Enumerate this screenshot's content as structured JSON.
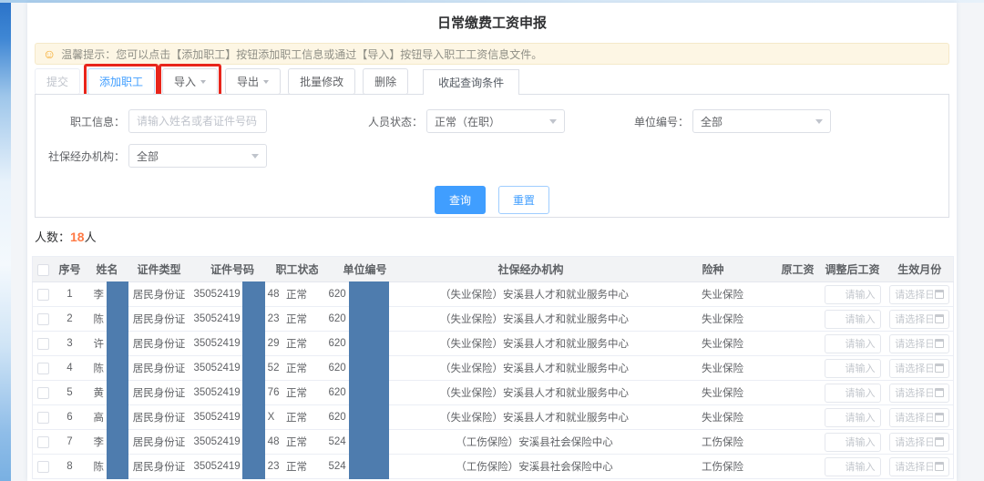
{
  "page": {
    "title": "日常缴费工资申报",
    "tip_icon": "☺",
    "tip_text": "温馨提示：您可以点击【添加职工】按钮添加职工信息或通过【导入】按钮导入职工工资信息文件。"
  },
  "toolbar": {
    "submit": "提交",
    "add_employee": "添加职工",
    "import": "导入",
    "export": "导出",
    "batch_edit": "批量修改",
    "delete": "删除",
    "collapse_tab": "收起查询条件"
  },
  "query": {
    "employee_info": {
      "label": "职工信息：",
      "placeholder": "请输入姓名或者证件号码"
    },
    "person_status": {
      "label": "人员状态：",
      "value": "正常（在职）"
    },
    "unit_no": {
      "label": "单位编号：",
      "value": "全部"
    },
    "agency": {
      "label": "社保经办机构：",
      "value": "全部"
    },
    "search": "查询",
    "reset": "重置"
  },
  "summary": {
    "label": "人数：",
    "count": "18",
    "unit": "人"
  },
  "table": {
    "headers": [
      "序号",
      "姓名",
      "证件类型",
      "证件号码",
      "职工状态",
      "单位编号",
      "社保经办机构",
      "险种",
      "原工资",
      "调整后工资",
      "生效月份"
    ],
    "wage_placeholder": "请输入",
    "month_placeholder": "请选择日期",
    "rows": [
      {
        "no": "1",
        "name_visible": "李",
        "id_type": "居民身份证",
        "id_prefix": "35052419",
        "id_suffix": "48",
        "status": "正常",
        "unit_prefix": "620",
        "agency": "（失业保险）安溪县人才和就业服务中心",
        "insurance": "失业保险",
        "old_wage": ""
      },
      {
        "no": "2",
        "name_visible": "陈",
        "id_type": "居民身份证",
        "id_prefix": "35052419",
        "id_suffix": "23",
        "status": "正常",
        "unit_prefix": "620",
        "agency": "（失业保险）安溪县人才和就业服务中心",
        "insurance": "失业保险",
        "old_wage": ""
      },
      {
        "no": "3",
        "name_visible": "许",
        "id_type": "居民身份证",
        "id_prefix": "35052419",
        "id_suffix": "29",
        "status": "正常",
        "unit_prefix": "620",
        "agency": "（失业保险）安溪县人才和就业服务中心",
        "insurance": "失业保险",
        "old_wage": ""
      },
      {
        "no": "4",
        "name_visible": "陈",
        "id_type": "居民身份证",
        "id_prefix": "35052419",
        "id_suffix": "52",
        "status": "正常",
        "unit_prefix": "620",
        "agency": "（失业保险）安溪县人才和就业服务中心",
        "insurance": "失业保险",
        "old_wage": ""
      },
      {
        "no": "5",
        "name_visible": "黄",
        "id_type": "居民身份证",
        "id_prefix": "35052419",
        "id_suffix": "76",
        "status": "正常",
        "unit_prefix": "620",
        "agency": "（失业保险）安溪县人才和就业服务中心",
        "insurance": "失业保险",
        "old_wage": ""
      },
      {
        "no": "6",
        "name_visible": "高",
        "id_type": "居民身份证",
        "id_prefix": "35052419",
        "id_suffix": "X",
        "status": "正常",
        "unit_prefix": "620",
        "agency": "（失业保险）安溪县人才和就业服务中心",
        "insurance": "失业保险",
        "old_wage": ""
      },
      {
        "no": "7",
        "name_visible": "李",
        "id_type": "居民身份证",
        "id_prefix": "35052419",
        "id_suffix": "48",
        "status": "正常",
        "unit_prefix": "524",
        "agency": "（工伤保险）安溪县社会保险中心",
        "insurance": "工伤保险",
        "old_wage": ""
      },
      {
        "no": "8",
        "name_visible": "陈",
        "id_type": "居民身份证",
        "id_prefix": "35052419",
        "id_suffix": "23",
        "status": "正常",
        "unit_prefix": "524",
        "agency": "（工伤保险）安溪县社会保险中心",
        "insurance": "工伤保险",
        "old_wage": ""
      }
    ]
  },
  "colors": {
    "accent": "#409eff",
    "count_highlight": "#ff7a45",
    "redaction_bar": "#4e7cae",
    "annotation_box": "#e8251b",
    "tip_background": "#fdf6e4"
  }
}
